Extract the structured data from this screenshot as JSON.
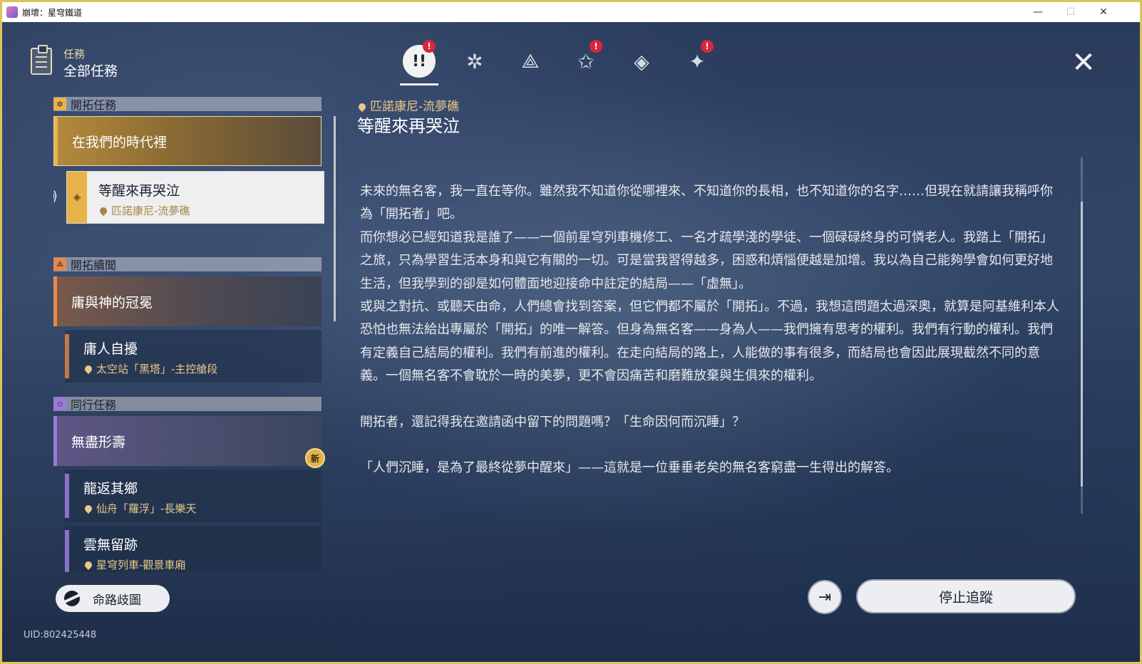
{
  "window": {
    "title": "崩壞：星穹鐵道"
  },
  "header": {
    "subtitle": "任務",
    "title": "全部任務"
  },
  "tabs": [
    {
      "icon": "exclamation-icon",
      "glyph": "!!",
      "active": true,
      "badge": "!"
    },
    {
      "icon": "compass-star-icon",
      "glyph": "✲",
      "active": false,
      "badge": ""
    },
    {
      "icon": "triangle-star-icon",
      "glyph": "⟁",
      "active": false,
      "badge": ""
    },
    {
      "icon": "star-icon",
      "glyph": "✩",
      "active": false,
      "badge": "!"
    },
    {
      "icon": "diamond-icon",
      "glyph": "◈",
      "active": false,
      "badge": ""
    },
    {
      "icon": "diamond-star-icon",
      "glyph": "✦",
      "active": false,
      "badge": "!"
    }
  ],
  "categories": [
    {
      "label": "開拓任務",
      "color": "#e8b44a",
      "main": "在我們的時代裡",
      "subs": [
        {
          "name": "等醒來再哭泣",
          "location": "匹諾康尼-流夢礁"
        }
      ]
    },
    {
      "label": "開拓續聞",
      "color": "#e8884a",
      "main": "庸與神的冠冕",
      "subs": [
        {
          "name": "庸人自擾",
          "location": "太空站「黑塔」-主控艙段"
        }
      ]
    },
    {
      "label": "同行任務",
      "color": "#9b7ad8",
      "main": "無盡形壽",
      "subs": [
        {
          "name": "龍返其鄉",
          "location": "仙舟「羅浮」-長樂天"
        },
        {
          "name": "雲無留跡",
          "location": "星穹列車-觀景車廂"
        }
      ]
    }
  ],
  "new_badge": "新",
  "detail": {
    "location": "匹諾康尼-流夢礁",
    "title": "等醒來再哭泣",
    "paragraphs": [
      "未來的無名客，我一直在等你。雖然我不知道你從哪裡來、不知道你的長相，也不知道你的名字……但現在就請讓我稱呼你為「開拓者」吧。",
      "而你想必已經知道我是誰了——一個前星穹列車機修工、一名才疏學淺的學徒、一個碌碌終身的可憐老人。我踏上「開拓」之旅，只為學習生活本身和與它有關的一切。可是當我習得越多，困惑和煩惱便越是加增。我以為自己能夠學會如何更好地生活，但我學到的卻是如何體面地迎接命中註定的結局——「虛無」。",
      "或與之對抗、或聽天由命，人們總會找到答案，但它們都不屬於「開拓」。不過，我想這問題太過深奧，就算是阿基維利本人恐怕也無法給出專屬於「開拓」的唯一解答。但身為無名客——身為人——我們擁有思考的權利。我們有行動的權利。我們有定義自己結局的權利。我們有前進的權利。在走向結局的路上，人能做的事有很多，而結局也會因此展現截然不同的意義。一個無名客不會耽於一時的美夢，更不會因痛苦和磨難放棄與生俱來的權利。",
      "開拓者，還記得我在邀請函中留下的問題嗎？「生命因何而沉睡」？",
      "「人們沉睡，是為了最終從夢中醒來」——這就是一位垂垂老矣的無名客窮盡一生得出的解答。"
    ]
  },
  "buttons": {
    "path": "命路歧圖",
    "stop": "停止追蹤",
    "nav_glyph": "⇥"
  },
  "uid": "UID:802425448"
}
